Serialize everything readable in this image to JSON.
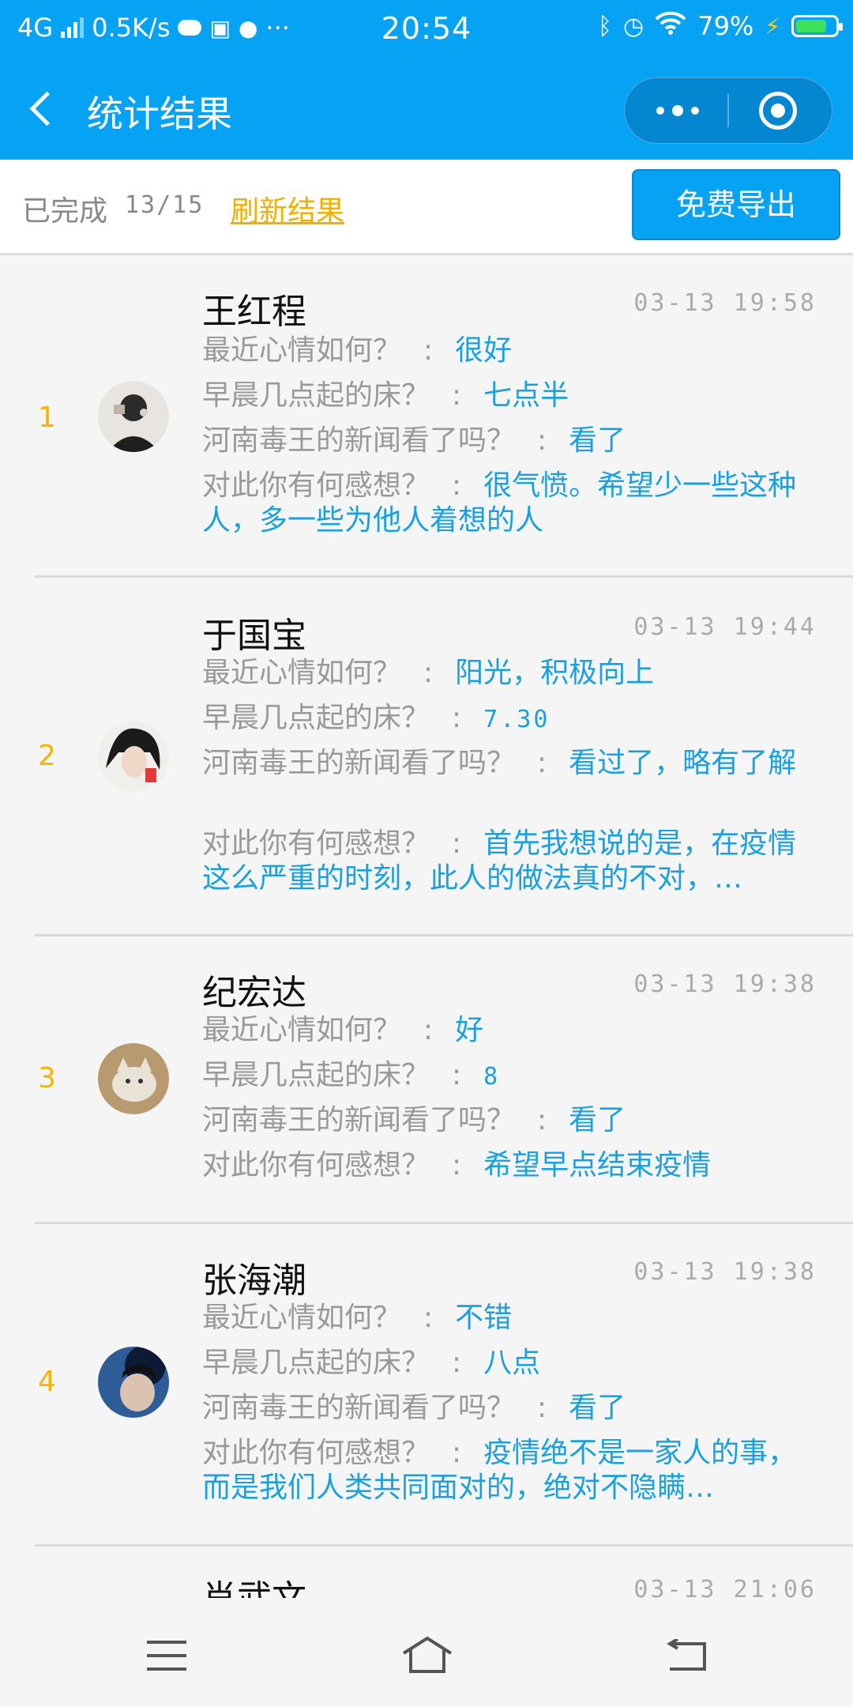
{
  "status_bar": {
    "network": "4G",
    "speed": "0.5K/s",
    "time": "20:54",
    "battery": "79%",
    "battery_level": 0.79,
    "icons": [
      "signal-icon",
      "cloud-icon",
      "shield-app-icon",
      "qq-icon",
      "more-icon",
      "bluetooth-icon",
      "alarm-icon",
      "wifi-icon",
      "charging-icon",
      "battery-icon"
    ]
  },
  "nav": {
    "title": "统计结果"
  },
  "summary": {
    "completed_label": "已完成",
    "count": "13/15",
    "refresh_label": "刷新结果",
    "export_label": "免费导出"
  },
  "records": [
    {
      "rank": "1",
      "name": "王红程",
      "time": "03-13 19:58",
      "answers": [
        {
          "q": "最近心情如何？",
          "a": "很好"
        },
        {
          "q": "早晨几点起的床？",
          "a": "七点半"
        },
        {
          "q": "河南毒王的新闻看了吗？",
          "a": "看了"
        },
        {
          "q": "对此你有何感想？",
          "a": "很气愤。希望少一些这种人，多一些为他人着想的人"
        }
      ]
    },
    {
      "rank": "2",
      "name": "于国宝",
      "time": "03-13 19:44",
      "answers": [
        {
          "q": "最近心情如何？",
          "a": "阳光，积极向上"
        },
        {
          "q": "早晨几点起的床？",
          "a": "7.30"
        },
        {
          "q": "河南毒王的新闻看了吗？",
          "a": "看过了，略有了解"
        },
        {
          "q": "对此你有何感想？",
          "a": "首先我想说的是，在疫情这么严重的时刻，此人的做法真的不对，…"
        }
      ]
    },
    {
      "rank": "3",
      "name": "纪宏达",
      "time": "03-13 19:38",
      "answers": [
        {
          "q": "最近心情如何？",
          "a": "好"
        },
        {
          "q": "早晨几点起的床？",
          "a": "8"
        },
        {
          "q": "河南毒王的新闻看了吗？",
          "a": "看了"
        },
        {
          "q": "对此你有何感想？",
          "a": "希望早点结束疫情"
        }
      ]
    },
    {
      "rank": "4",
      "name": "张海潮",
      "time": "03-13 19:38",
      "answers": [
        {
          "q": "最近心情如何？",
          "a": "不错"
        },
        {
          "q": "早晨几点起的床？",
          "a": "八点"
        },
        {
          "q": "河南毒王的新闻看了吗？",
          "a": "看了"
        },
        {
          "q": "对此你有何感想？",
          "a": "疫情绝不是一家人的事，而是我们人类共同面对的，绝对不隐瞒…"
        }
      ]
    },
    {
      "name": "肖武文",
      "time": "03-13 21:06"
    }
  ]
}
